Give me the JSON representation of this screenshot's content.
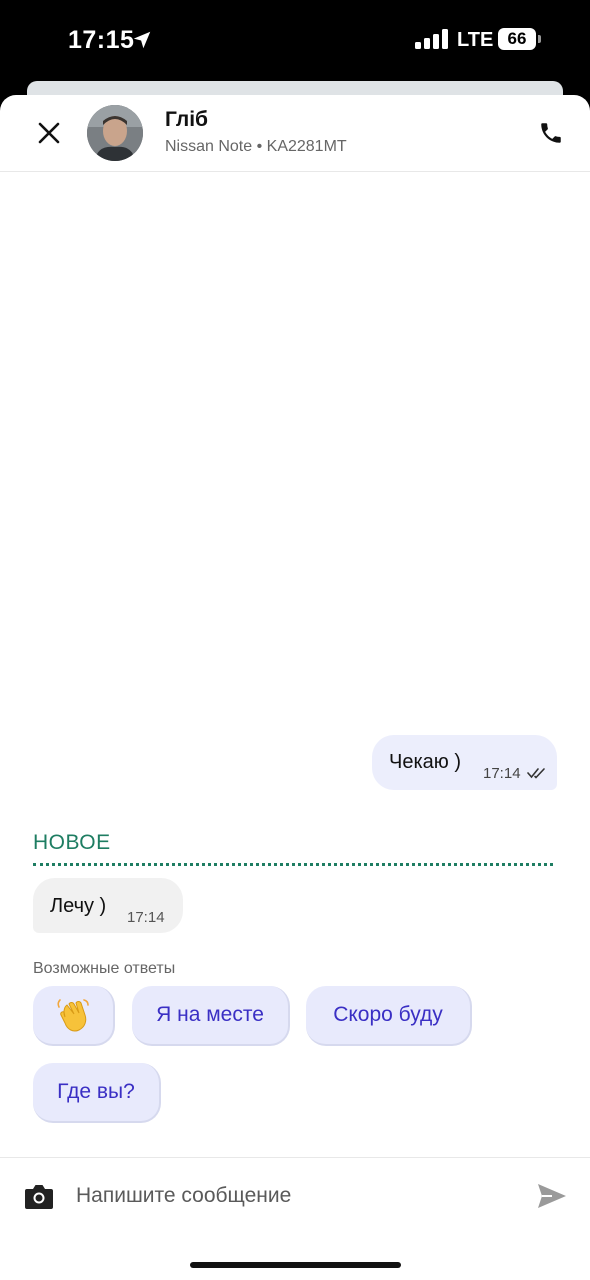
{
  "status_bar": {
    "time": "17:15",
    "network": "LTE",
    "battery": "66",
    "icons": [
      "location-arrow-icon",
      "signal-bars-icon"
    ]
  },
  "header": {
    "driver_name": "Гліб",
    "car_info": "Nissan Note • KA2281MT",
    "icons": [
      "close-icon",
      "phone-icon"
    ]
  },
  "messages": {
    "outgoing": {
      "text": "Чекаю )",
      "time": "17:14",
      "status_icon": "double-check-icon"
    },
    "new_label": "НОВОЕ",
    "incoming": {
      "text": "Лечу )",
      "time": "17:14"
    }
  },
  "quick_replies": {
    "label": "Возможные ответы",
    "chips": [
      "👋",
      "Я на месте",
      "Скоро буду",
      "Где вы?"
    ]
  },
  "composer": {
    "placeholder": "Напишите сообщение",
    "icons": [
      "camera-icon",
      "send-icon"
    ]
  },
  "colors": {
    "accent_green": "#1e7d62",
    "chip_bg": "#e8eafc",
    "chip_text": "#3a2fc4",
    "outgoing_bubble": "#eceefc",
    "incoming_bubble": "#f1f1f1"
  }
}
